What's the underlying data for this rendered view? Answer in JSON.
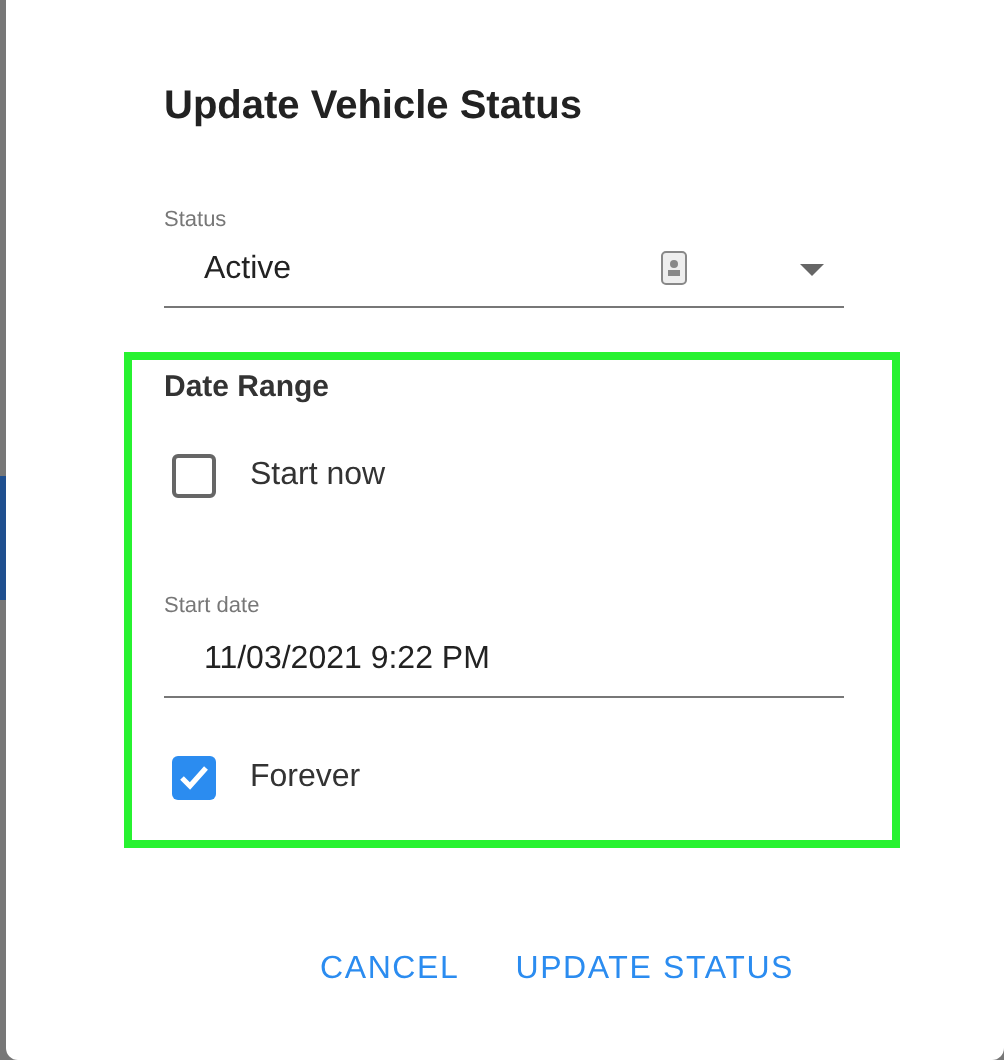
{
  "dialog": {
    "title": "Update Vehicle Status"
  },
  "status_field": {
    "label": "Status",
    "value": "Active"
  },
  "date_range": {
    "title": "Date Range",
    "start_now": {
      "label": "Start now",
      "checked": false
    },
    "start_date": {
      "label": "Start date",
      "value": "11/03/2021 9:22 PM"
    },
    "forever": {
      "label": "Forever",
      "checked": true
    }
  },
  "buttons": [
    "CANCEL",
    "UPDATE STATUS"
  ]
}
